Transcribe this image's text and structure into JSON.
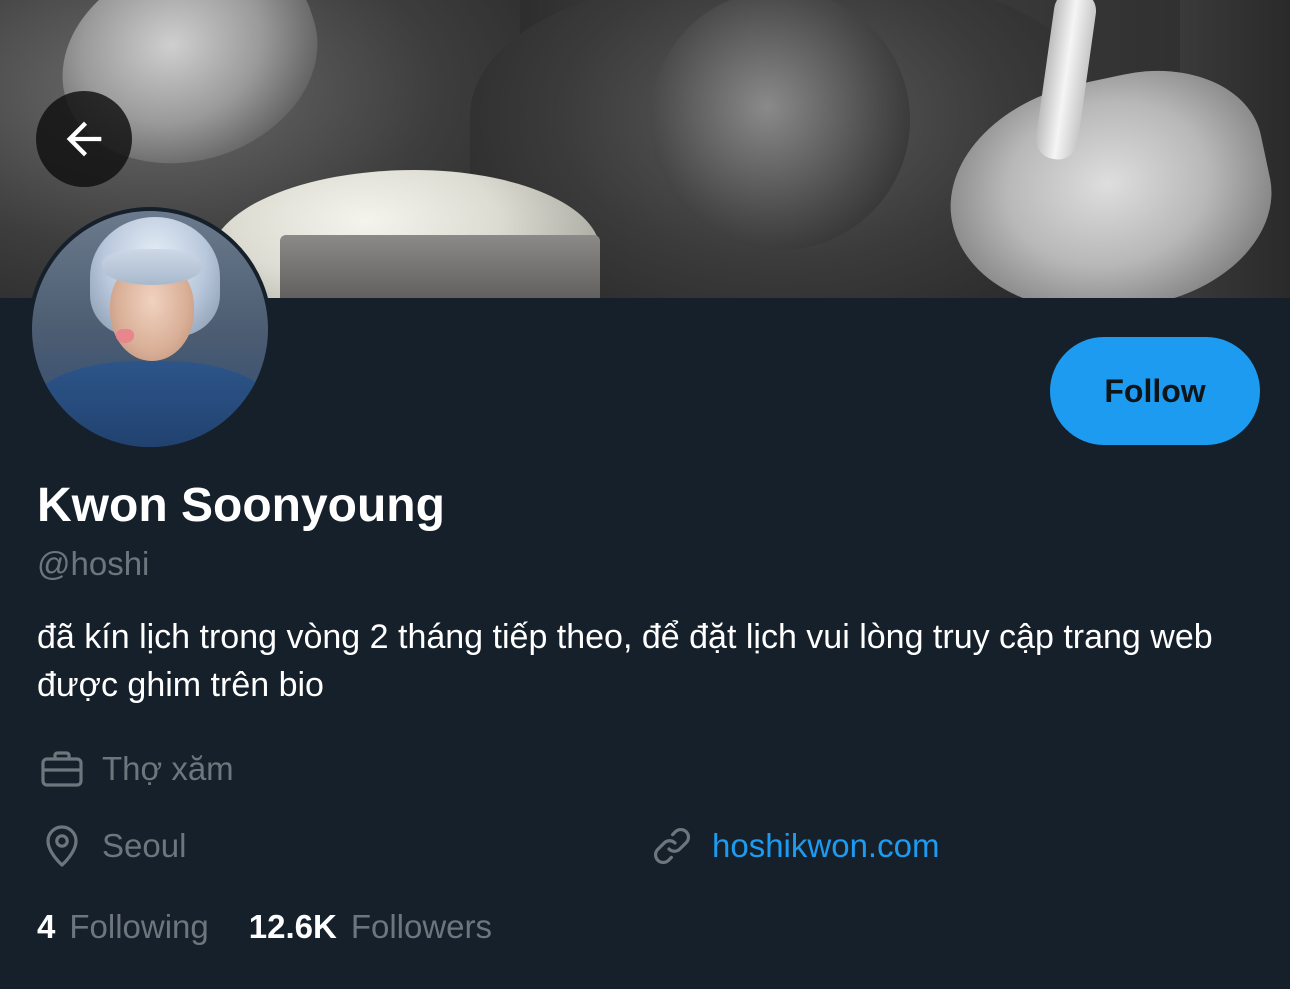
{
  "profile": {
    "name": "Kwon Soonyoung",
    "handle": "@hoshi",
    "bio": "đã kín lịch trong vòng 2 tháng tiếp theo, để đặt lịch vui lòng truy cập trang web được ghim trên bio",
    "job": "Thợ xăm",
    "location": "Seoul",
    "website": "hoshikwon.com"
  },
  "actions": {
    "follow_label": "Follow",
    "back_icon": "arrow-left-icon"
  },
  "stats": {
    "following_count": "4",
    "following_label": "Following",
    "followers_count": "12.6K",
    "followers_label": "Followers"
  },
  "icons": {
    "job": "briefcase-icon",
    "location": "map-pin-icon",
    "website": "link-icon"
  },
  "colors": {
    "background": "#15202b",
    "accent": "#1d9bf0",
    "secondary_text": "#6e767d",
    "primary_text": "#ffffff"
  }
}
